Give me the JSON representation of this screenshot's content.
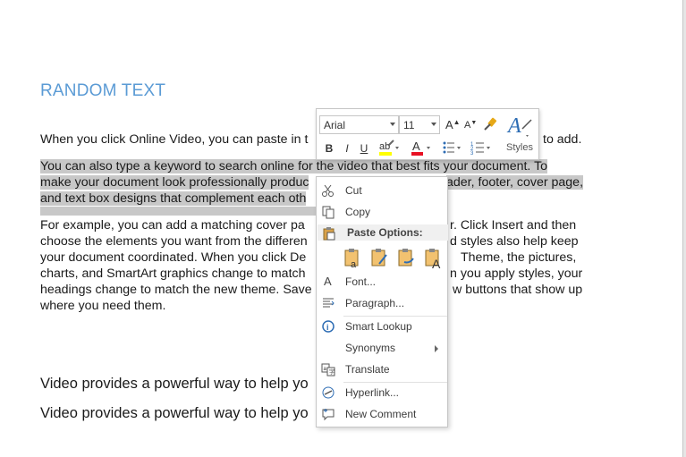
{
  "document": {
    "heading": "RANDOM TEXT",
    "para1_left": "When you click Online Video, you can paste in t",
    "para1_right": "to add.",
    "para2_line1": "You can also type a keyword to search online for the video that best fits your document. To",
    "para2_line2_left": "make your document look professionally produc",
    "para2_line2_right": "ader, footer, cover page,",
    "para2_line3_left": "and text box designs that complement each oth",
    "para3_line1_left": "For example, you can add a matching cover pa",
    "para3_line1_right": "r. Click Insert and then",
    "para3_line2_left": "choose the elements you want from the differen",
    "para3_line2_right": "d styles also help keep",
    "para3_line3_left": "your document coordinated. When you click De",
    "para3_line3_right": "Theme, the pictures,",
    "para3_line4_left": "charts, and SmartArt graphics change to match",
    "para3_line4_right": "n you apply styles, your",
    "para3_line5_left": "headings change to match the new theme. Save",
    "para3_line5_right": "w buttons that show up",
    "para3_line6": "where you need them.",
    "line_a": "Video provides a powerful way to help yo",
    "line_b": "Video provides a powerful way to help yo"
  },
  "minibar": {
    "font": "Arial",
    "size": "11",
    "bold": "B",
    "italic": "I",
    "underline": "U",
    "styles": "Styles",
    "colors": {
      "highlight": "#ffff00",
      "font_color": "#e81123",
      "styles_accent": "#2e6db4"
    }
  },
  "context_menu": {
    "items": [
      {
        "label": "Cut",
        "icon": "scissors-icon"
      },
      {
        "label": "Copy",
        "icon": "copy-icon"
      },
      {
        "label": "Paste Options:",
        "icon": "paste-icon"
      },
      {
        "label": "Font...",
        "icon": "font-icon"
      },
      {
        "label": "Paragraph...",
        "icon": "paragraph-icon"
      },
      {
        "label": "Smart Lookup",
        "icon": "search-icon"
      },
      {
        "label": "Synonyms",
        "icon": ""
      },
      {
        "label": "Translate",
        "icon": "translate-icon"
      },
      {
        "label": "Hyperlink...",
        "icon": "link-icon"
      },
      {
        "label": "New Comment",
        "icon": "comment-icon"
      }
    ]
  }
}
